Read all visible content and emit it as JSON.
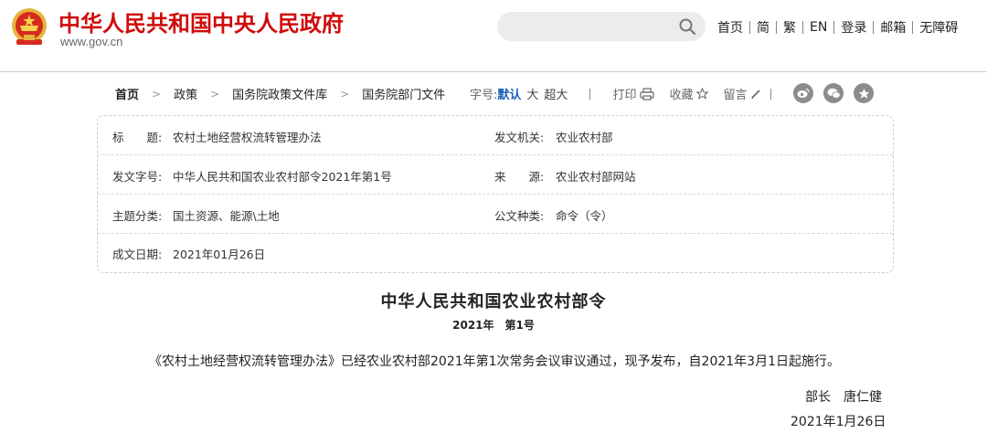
{
  "header": {
    "site_title": "中华人民共和国中央人民政府",
    "site_url": "www.gov.cn",
    "search": {
      "placeholder": ""
    },
    "nav": [
      "首页",
      "简",
      "繁",
      "EN",
      "登录",
      "邮箱",
      "无障碍"
    ],
    "emblem_icon": "national-emblem-icon",
    "title_color": "#d00b0b"
  },
  "breadcrumb": [
    "首页",
    "政策",
    "国务院政策文件库",
    "国务院部门文件"
  ],
  "tools": {
    "font_size_label": "字号:",
    "sizes": [
      "默认",
      "大",
      "超大"
    ],
    "selected_size": "默认",
    "print": "打印",
    "favorite": "收藏",
    "comment": "留言",
    "share_icons": [
      "weibo-icon",
      "wechat-icon",
      "star-icon"
    ],
    "accent_color": "#1c61b7"
  },
  "meta": {
    "title_key": "标　　题:",
    "title_val": "农村土地经营权流转管理办法",
    "issuer_key": "发文机关:",
    "issuer_val": "农业农村部",
    "doc_no_key": "发文字号:",
    "doc_no_val": "中华人民共和国农业农村部令2021年第1号",
    "source_key": "来　　源:",
    "source_val": "农业农村部网站",
    "topic_key": "主题分类:",
    "topic_val": "国土资源、能源\\土地",
    "type_key": "公文种类:",
    "type_val": "命令（令）",
    "date_key": "成文日期:",
    "date_val": "2021年01月26日"
  },
  "document": {
    "heading": "中华人民共和国农业农村部令",
    "number": "2021年　第1号",
    "body": "《农村土地经营权流转管理办法》已经农业农村部2021年第1次常务会议审议通过，现予发布，自2021年3月1日起施行。",
    "signature": "部长　唐仁健",
    "date": "2021年1月26日"
  }
}
